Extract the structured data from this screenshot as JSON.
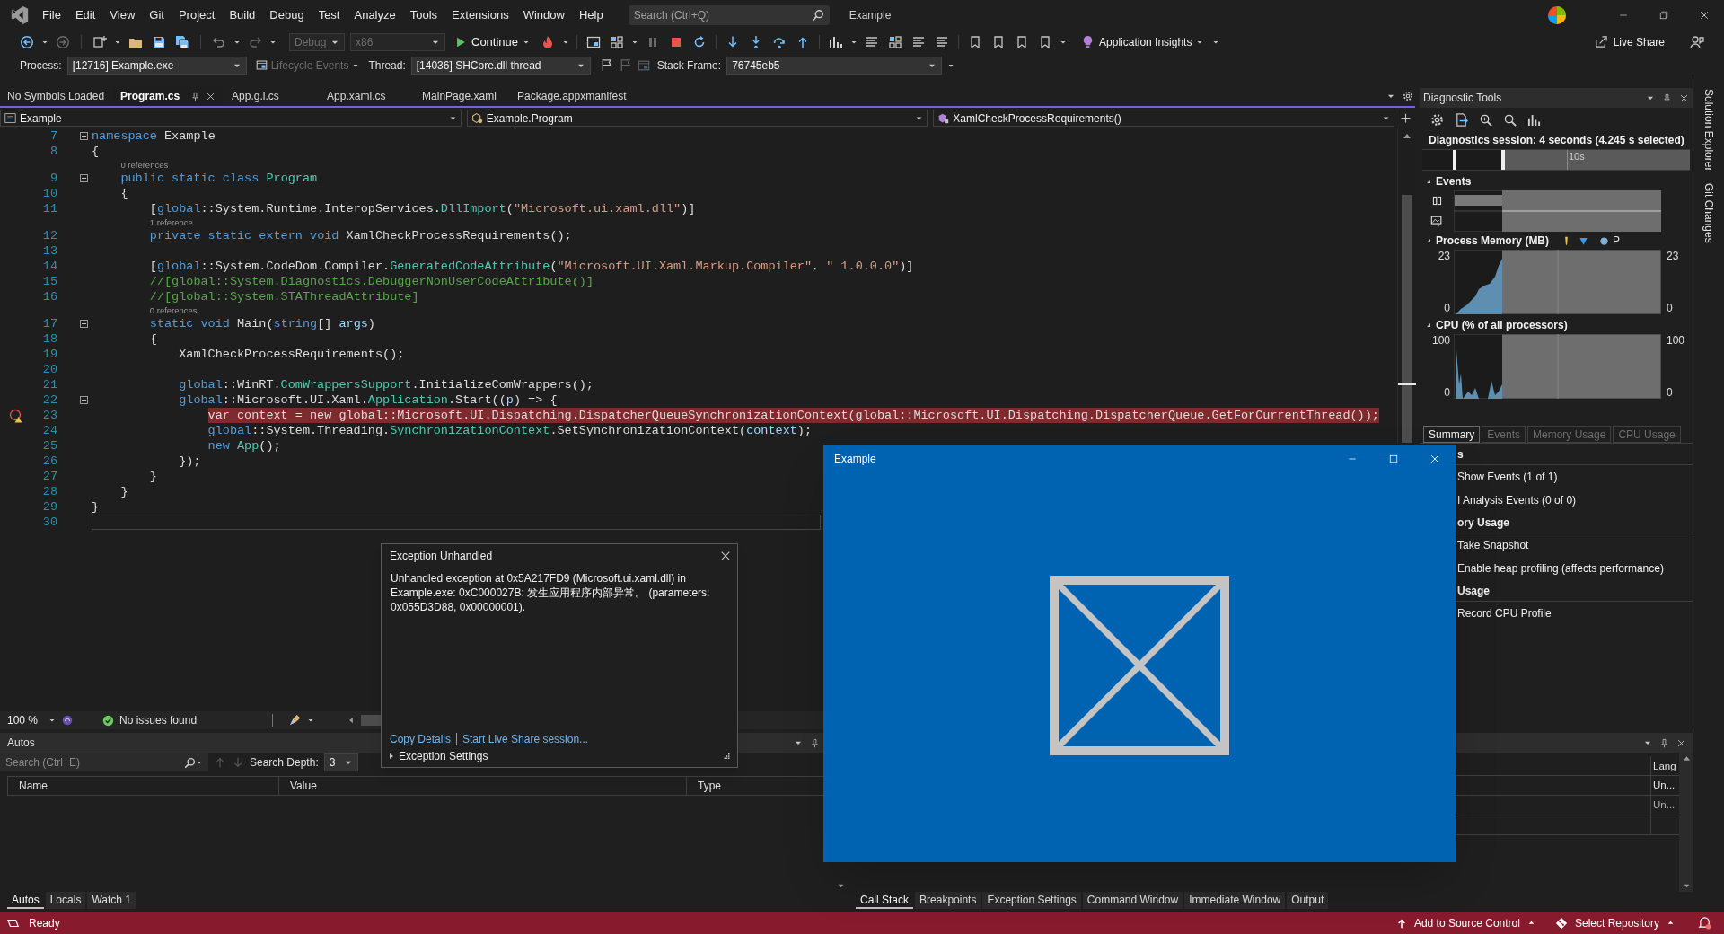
{
  "menu_bar": {
    "items": [
      "File",
      "Edit",
      "View",
      "Git",
      "Project",
      "Build",
      "Debug",
      "Test",
      "Analyze",
      "Tools",
      "Extensions",
      "Window",
      "Help"
    ],
    "search": {
      "placeholder": "Search (Ctrl+Q)"
    },
    "title": "Example"
  },
  "toolbar": {
    "configuration": {
      "label": "Debug",
      "disabled": true
    },
    "platform": {
      "label": "x86",
      "disabled": true
    },
    "continue_button": "Continue",
    "insights_button": "Application Insights",
    "live_share_button": "Live Share"
  },
  "debug_location": {
    "process_label": "Process:",
    "process": "[12716] Example.exe",
    "lifecycle": {
      "label": "Lifecycle Events",
      "disabled": true
    },
    "thread_label": "Thread:",
    "thread": "[14036] SHCore.dll thread",
    "stack_frame_label": "Stack Frame:",
    "stack_frame": "76745eb5"
  },
  "editor": {
    "tabs": [
      {
        "label": "No Symbols Loaded",
        "selected": false
      },
      {
        "label": "Program.cs",
        "selected": true
      },
      {
        "label": "App.g.i.cs",
        "selected": false
      },
      {
        "label": "App.xaml.cs",
        "selected": false
      },
      {
        "label": "MainPage.xaml",
        "selected": false
      },
      {
        "label": "Package.appxmanifest",
        "selected": false
      }
    ],
    "nav": [
      "Example",
      "Example.Program",
      "XamlCheckProcessRequirements()"
    ],
    "lines": [
      {
        "number": "7",
        "fold": true,
        "current": false,
        "cursor": false,
        "tokens": [
          {
            "kind": "k",
            "text": "namespace"
          },
          {
            "kind": "p",
            "text": " Example"
          }
        ]
      },
      {
        "number": "8",
        "fold": false,
        "current": false,
        "cursor": false,
        "tokens": [
          {
            "kind": "p",
            "text": "{"
          }
        ]
      },
      {
        "number": "9",
        "lens": "0 references",
        "fold": true,
        "current": false,
        "cursor": false,
        "tokens": [
          {
            "kind": "k",
            "text": "    public static class"
          },
          {
            "kind": "t",
            "text": " Program"
          }
        ]
      },
      {
        "number": "10",
        "fold": false,
        "current": false,
        "cursor": false,
        "tokens": [
          {
            "kind": "p",
            "text": "    {"
          }
        ]
      },
      {
        "number": "11",
        "fold": false,
        "current": false,
        "cursor": false,
        "tokens": [
          {
            "kind": "p",
            "text": "        ["
          },
          {
            "kind": "k",
            "text": "global"
          },
          {
            "kind": "p",
            "text": "::System.Runtime.InteropServices."
          },
          {
            "kind": "t",
            "text": "DllImport"
          },
          {
            "kind": "p",
            "text": "("
          },
          {
            "kind": "s",
            "text": "\"Microsoft.ui.xaml.dll\""
          },
          {
            "kind": "p",
            "text": ")]"
          }
        ]
      },
      {
        "number": "12",
        "lens": "1 reference",
        "fold": false,
        "current": false,
        "cursor": false,
        "tokens": [
          {
            "kind": "k",
            "text": "        private static extern void"
          },
          {
            "kind": "p",
            "text": " XamlCheckProcessRequirements();"
          }
        ]
      },
      {
        "number": "13",
        "fold": false,
        "current": false,
        "cursor": false
      },
      {
        "number": "14",
        "fold": false,
        "current": false,
        "cursor": false,
        "tokens": [
          {
            "kind": "p",
            "text": "        ["
          },
          {
            "kind": "k",
            "text": "global"
          },
          {
            "kind": "p",
            "text": "::System.CodeDom.Compiler."
          },
          {
            "kind": "t",
            "text": "GeneratedCodeAttribute"
          },
          {
            "kind": "p",
            "text": "("
          },
          {
            "kind": "s",
            "text": "\"Microsoft.UI.Xaml.Markup.Compiler\""
          },
          {
            "kind": "p",
            "text": ", "
          },
          {
            "kind": "s",
            "text": "\" 1.0.0.0\""
          },
          {
            "kind": "p",
            "text": ")]"
          }
        ]
      },
      {
        "number": "15",
        "fold": false,
        "current": false,
        "cursor": false,
        "tokens": [
          {
            "kind": "c",
            "text": "        //[global::System.Diagnostics.DebuggerNonUserCodeAttribute()]"
          }
        ]
      },
      {
        "number": "16",
        "fold": false,
        "current": false,
        "cursor": false,
        "tokens": [
          {
            "kind": "c",
            "text": "        //[global::System.STAThreadAttribute]"
          }
        ]
      },
      {
        "number": "17",
        "lens": "0 references",
        "fold": true,
        "current": false,
        "cursor": false,
        "tokens": [
          {
            "kind": "k",
            "text": "        static void"
          },
          {
            "kind": "p",
            "text": " Main("
          },
          {
            "kind": "k",
            "text": "string"
          },
          {
            "kind": "p",
            "text": "[] "
          },
          {
            "kind": "v",
            "text": "args"
          },
          {
            "kind": "p",
            "text": ")"
          }
        ]
      },
      {
        "number": "18",
        "fold": false,
        "current": false,
        "cursor": false,
        "tokens": [
          {
            "kind": "p",
            "text": "        {"
          }
        ]
      },
      {
        "number": "19",
        "fold": false,
        "current": false,
        "cursor": false,
        "tokens": [
          {
            "kind": "p",
            "text": "            XamlCheckProcessRequirements();"
          }
        ]
      },
      {
        "number": "20",
        "fold": false,
        "current": false,
        "cursor": false
      },
      {
        "number": "21",
        "fold": false,
        "current": false,
        "cursor": false,
        "tokens": [
          {
            "kind": "k",
            "text": "            global"
          },
          {
            "kind": "p",
            "text": "::WinRT."
          },
          {
            "kind": "t",
            "text": "ComWrappersSupport"
          },
          {
            "kind": "p",
            "text": ".InitializeComWrappers();"
          }
        ]
      },
      {
        "number": "22",
        "fold": true,
        "current": false,
        "cursor": false,
        "tokens": [
          {
            "kind": "k",
            "text": "            global"
          },
          {
            "kind": "p",
            "text": "::Microsoft.UI.Xaml."
          },
          {
            "kind": "t",
            "text": "Application"
          },
          {
            "kind": "p",
            "text": ".Start(("
          },
          {
            "kind": "v",
            "text": "p"
          },
          {
            "kind": "p",
            "text": ") => {"
          }
        ]
      },
      {
        "number": "23",
        "fold": false,
        "current": true,
        "cursor": false,
        "tokens": [
          {
            "kind": "p",
            "text": "                var context = new global::Microsoft.UI.Dispatching.DispatcherQueueSynchronizationContext(global::Microsoft.UI.Dispatching.DispatcherQueue.GetForCurrentThread());"
          }
        ]
      },
      {
        "number": "24",
        "fold": false,
        "current": false,
        "cursor": false,
        "tokens": [
          {
            "kind": "k",
            "text": "                global"
          },
          {
            "kind": "p",
            "text": "::System.Threading."
          },
          {
            "kind": "t",
            "text": "SynchronizationContext"
          },
          {
            "kind": "p",
            "text": ".SetSynchronizationContext("
          },
          {
            "kind": "v",
            "text": "context"
          },
          {
            "kind": "p",
            "text": ");"
          }
        ]
      },
      {
        "number": "25",
        "fold": false,
        "current": false,
        "cursor": false,
        "tokens": [
          {
            "kind": "k",
            "text": "                new"
          },
          {
            "kind": "t",
            "text": " App"
          },
          {
            "kind": "p",
            "text": "();"
          }
        ]
      },
      {
        "number": "26",
        "fold": false,
        "current": false,
        "cursor": false,
        "tokens": [
          {
            "kind": "p",
            "text": "            });"
          }
        ]
      },
      {
        "number": "27",
        "fold": false,
        "current": false,
        "cursor": false,
        "tokens": [
          {
            "kind": "p",
            "text": "        }"
          }
        ]
      },
      {
        "number": "28",
        "fold": false,
        "current": false,
        "cursor": false,
        "tokens": [
          {
            "kind": "p",
            "text": "    }"
          }
        ]
      },
      {
        "number": "29",
        "fold": false,
        "current": false,
        "cursor": false,
        "tokens": [
          {
            "kind": "p",
            "text": "}"
          }
        ]
      },
      {
        "number": "30",
        "fold": false,
        "current": false,
        "cursor": true
      }
    ],
    "zoom": "100 %",
    "issues": "No issues found"
  },
  "exception_dialog": {
    "title": "Exception Unhandled",
    "message": "Unhandled exception at 0x5A217FD9 (Microsoft.ui.xaml.dll) in Example.exe: 0xC000027B: 发生应用程序内部异常。 (parameters: 0x055D3D88, 0x00000001).",
    "links": [
      "Copy Details",
      "Start Live Share session..."
    ],
    "settings": {
      "label": "Exception Settings",
      "expanded": false
    }
  },
  "diagnostic_tools": {
    "title": "Diagnostic Tools",
    "session": "Diagnostics session: 4 seconds (4.245 s selected)",
    "ruler_label": "10s",
    "events_title": "Events",
    "memory": {
      "title": "Process Memory (MB)",
      "legend": "P",
      "left_ticks": [
        "23",
        "0"
      ],
      "right_ticks": [
        "23",
        "0"
      ]
    },
    "cpu": {
      "title": "CPU (% of all processors)",
      "left_ticks": [
        "100",
        "0"
      ],
      "right_ticks": [
        "100",
        "0"
      ]
    },
    "tabs": [
      {
        "label": "Summary",
        "selected": true
      },
      {
        "label": "Events",
        "selected": false
      },
      {
        "label": "Memory Usage",
        "selected": false
      },
      {
        "label": "CPU Usage",
        "selected": false
      }
    ],
    "sections": [
      {
        "title": "s",
        "items": [
          "Show Events (1 of 1)",
          "I Analysis Events (0 of 0)"
        ]
      },
      {
        "title": "ory Usage",
        "items": [
          "Take Snapshot",
          "Enable heap profiling (affects performance)"
        ]
      },
      {
        "title": "Usage",
        "items": [
          "Record CPU Profile"
        ]
      }
    ]
  },
  "autos": {
    "title": "Autos",
    "search": {
      "placeholder": "Search (Ctrl+E)"
    },
    "depth_label": "Search Depth:",
    "depth": "3",
    "columns": [
      "Name",
      "Value",
      "Type"
    ],
    "tabs": [
      {
        "label": "Autos",
        "selected": true
      },
      {
        "label": "Locals",
        "selected": false
      },
      {
        "label": "Watch 1",
        "selected": false
      }
    ]
  },
  "lower_right_panel": {
    "column": "Lang",
    "rows": [
      "Un...",
      "Un..."
    ],
    "tabs": [
      {
        "label": "Call Stack",
        "selected": true
      },
      {
        "label": "Breakpoints",
        "selected": false
      },
      {
        "label": "Exception Settings",
        "selected": false
      },
      {
        "label": "Command Window",
        "selected": false
      },
      {
        "label": "Immediate Window",
        "selected": false
      },
      {
        "label": "Output",
        "selected": false
      }
    ]
  },
  "app_window": {
    "title": "Example"
  },
  "side_tabs": [
    "Solution Explorer",
    "Git Changes"
  ],
  "status_bar": {
    "text": "Ready",
    "source_control": "Add to Source Control",
    "repository": "Select Repository"
  }
}
